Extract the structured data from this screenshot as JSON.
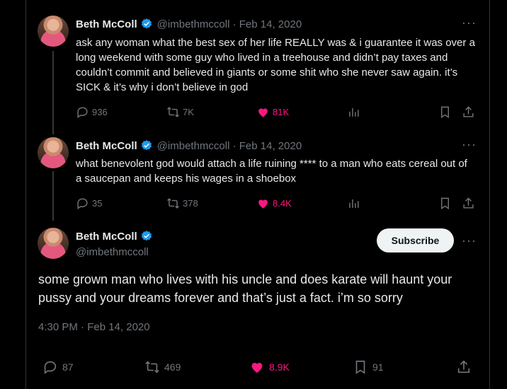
{
  "colors": {
    "accent_pink": "#f91880",
    "verified_blue": "#1d9bf0",
    "muted": "#71767b"
  },
  "tweets": [
    {
      "name": "Beth McColl",
      "handle": "@imbethmccoll",
      "date": "· Feb 14, 2020",
      "text": "ask any woman what the best sex of her life REALLY was & i guarantee it was over a long weekend with some guy who lived in a treehouse and didn’t pay taxes and couldn’t commit and believed in giants or some shit who she never saw again. it’s SICK & it’s why i don’t believe in god",
      "replies": "936",
      "retweets": "7K",
      "likes": "81K"
    },
    {
      "name": "Beth McColl",
      "handle": "@imbethmccoll",
      "date": "· Feb 14, 2020",
      "text": "what benevolent god would attach a life ruining **** to a man who eats cereal out of a saucepan and keeps his wages in a shoebox",
      "replies": "35",
      "retweets": "378",
      "likes": "8.4K"
    }
  ],
  "main_tweet": {
    "name": "Beth McColl",
    "handle": "@imbethmccoll",
    "subscribe_label": "Subscribe",
    "text": "some grown man who lives with his uncle and does karate will haunt your pussy and your dreams forever and that’s just a fact. i’m so sorry",
    "timestamp": "4:30 PM · Feb 14, 2020",
    "replies": "87",
    "retweets": "469",
    "likes": "8.9K",
    "bookmarks": "91"
  },
  "icons": [
    "verified-icon",
    "more-icon",
    "reply-icon",
    "retweet-icon",
    "like-icon",
    "views-icon",
    "bookmark-icon",
    "share-icon"
  ]
}
